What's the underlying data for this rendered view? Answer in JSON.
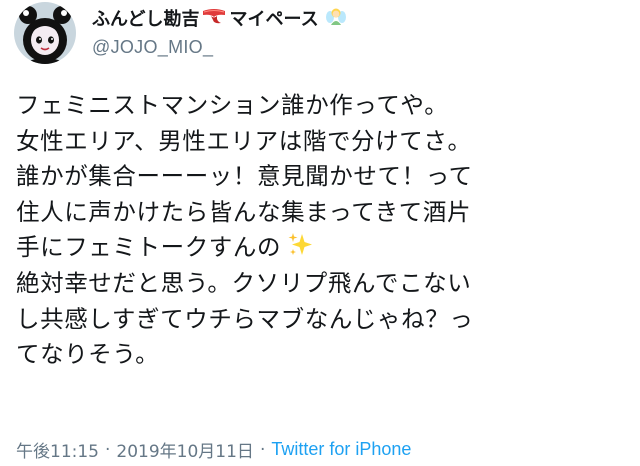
{
  "tweet": {
    "author": {
      "display_name": "ふんどし勘吉",
      "display_name_suffix": "マイペース",
      "handle": "@JOJO_MIO_",
      "icons": [
        "red-fundoshi-icon",
        "fairy-emoji-icon"
      ]
    },
    "text_lines": [
      "フェミニストマンション誰か作ってや。",
      "女性エリア、男性エリアは階で分けてさ。",
      "誰かが集合ーーーッ！意見聞かせて！って",
      "住人に声かけたら皆んな集まってきて酒片",
      "手にフェミトークすんの",
      "絶対幸せだと思う。クソリプ飛んでこない",
      "し共感しすぎてウチらマブなんじゃね？っ",
      "てなりそう。"
    ],
    "inline_emoji": "sparkles-emoji",
    "meta": {
      "time": "午後11:15",
      "date": "2019年10月11日",
      "separator": "·",
      "source": "Twitter for iPhone"
    },
    "colors": {
      "text": "#14171a",
      "secondary": "#657786",
      "link": "#1da1f2"
    }
  }
}
